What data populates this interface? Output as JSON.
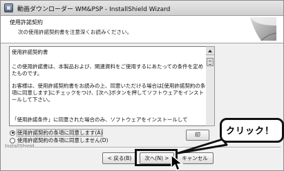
{
  "window": {
    "title": "動画ダウンローダー WM&PSP - InstallShield Wizard"
  },
  "header": {
    "title": "使用許諾契約",
    "subtitle": "次の使用許諾契約書を注意深くお読みください。"
  },
  "license": {
    "heading": "使用許諾契約書",
    "paragraph1": "この使用許諾書は、本製品および、関連資料をご使用するにあたっての条件を定めたものです。",
    "paragraph2": "お客様は、使用許諾契約書をお読みの上、同意いただける場合は[使用許諾契約の条項に同意します]にチェックをつけ、[次へ]ボタンを押してソフトウェアをインストールして下さい。",
    "paragraph3": "「使用許諾条件」に同意された場合のみ、ソフトウェアをインストールして"
  },
  "options": {
    "accept": "使用許諾契約の条項に同意します(A)",
    "decline": "使用許諾契約の条項に同意しません(D)",
    "selected": "accept"
  },
  "buttons": {
    "print": "印",
    "back": "< 戻る(B)",
    "next": "次へ(N) >",
    "cancel": "キャンセル"
  },
  "footer": {
    "brand": "InstallShield"
  },
  "annotation": {
    "callout": "クリック！"
  },
  "icons": {
    "window_icon": "installer-icon",
    "header_graphic": "folded-page-graphic",
    "cursor": "mouse-pointer-icon"
  }
}
